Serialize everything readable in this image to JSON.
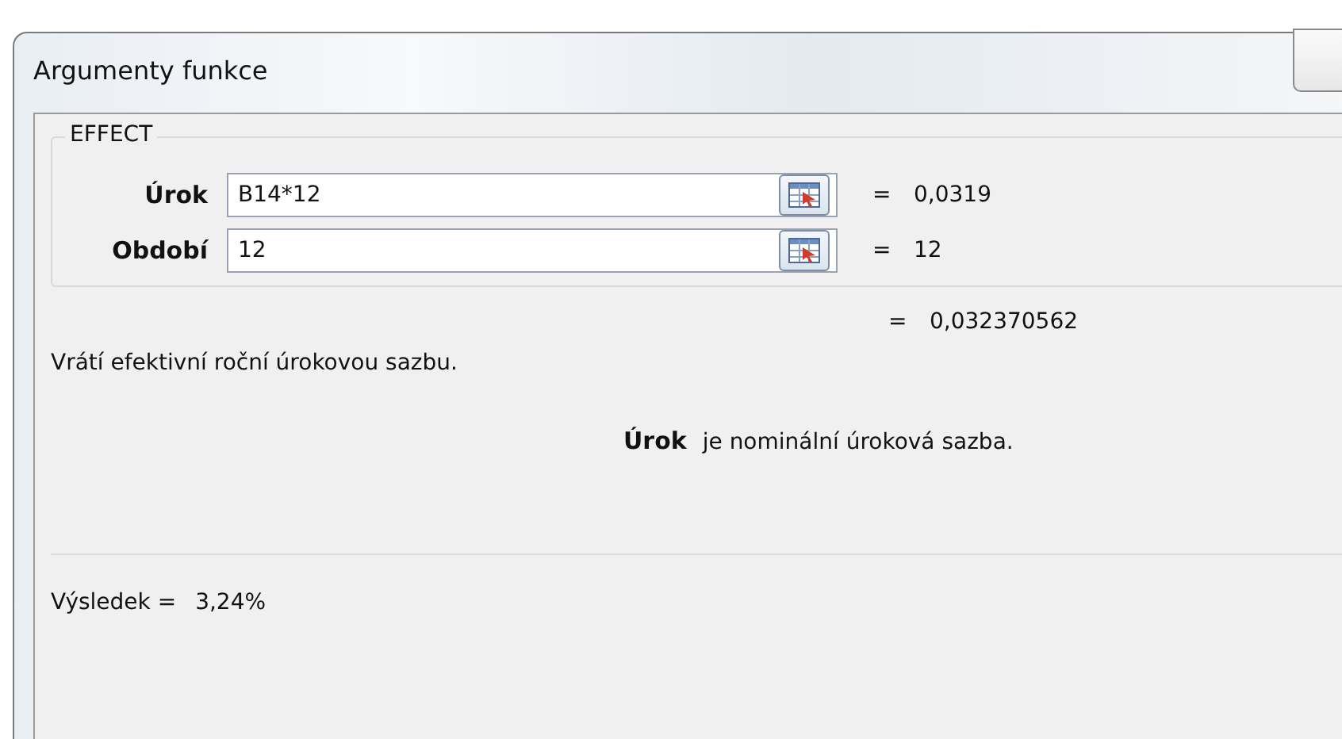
{
  "window": {
    "title": "Argumenty funkce"
  },
  "function": {
    "name": "EFFECT"
  },
  "arguments": [
    {
      "label": "Úrok",
      "value": "B14*12",
      "equals": "=",
      "result": "0,0319"
    },
    {
      "label": "Období",
      "value": "12",
      "equals": "=",
      "result": "12"
    }
  ],
  "formula_result": {
    "equals": "=",
    "value": "0,032370562"
  },
  "description": "Vrátí efektivní roční úrokovou sazbu.",
  "argument_help": {
    "name": "Úrok",
    "text": "je nominální úroková sazba."
  },
  "result": {
    "label": "Výsledek =",
    "value": "3,24%"
  }
}
